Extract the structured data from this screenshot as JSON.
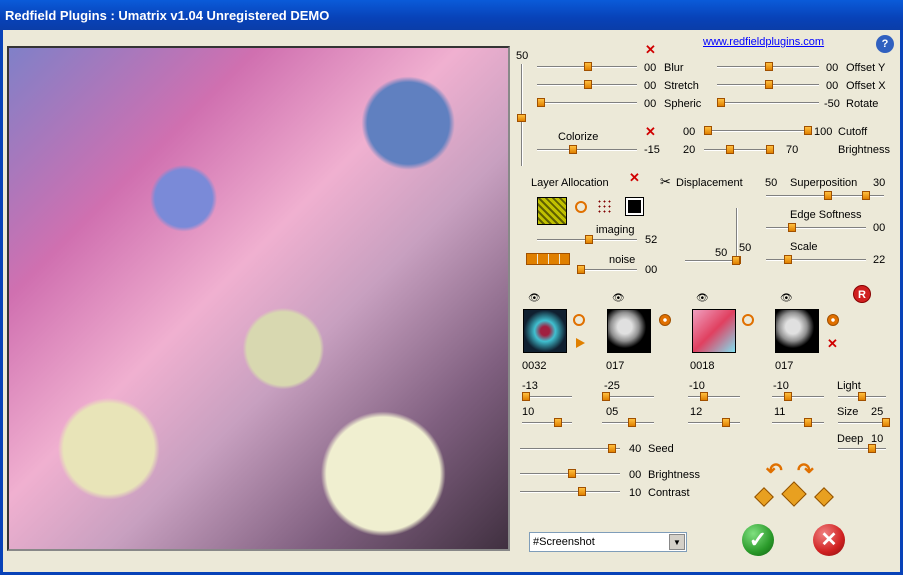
{
  "title": "Redfield Plugins : Umatrix v1.04    Unregistered  DEMO",
  "link": "www.redfieldplugins.com",
  "help": "?",
  "top": {
    "v50": "50",
    "blur": {
      "val": "00",
      "label": "Blur"
    },
    "stretch": {
      "val": "00",
      "label": "Stretch"
    },
    "spheric": {
      "val": "00",
      "label": "Spheric"
    },
    "offsety": {
      "val": "00",
      "label": "Offset Y"
    },
    "offsetx": {
      "val": "00",
      "label": "Offset X"
    },
    "rotate": {
      "val": "-50",
      "label": "Rotate"
    },
    "colorize": {
      "label": "Colorize",
      "val": "-15"
    },
    "cutoff": {
      "lo": "00",
      "hi": "100",
      "label": "Cutoff"
    },
    "brightness": {
      "lo": "20",
      "hi": "70",
      "label": "Brightness"
    }
  },
  "layer": {
    "label": "Layer Allocation",
    "imaging": "imaging",
    "imaging_val": "52",
    "noise": "noise",
    "noise_val": "00"
  },
  "disp": {
    "label": "Displacement",
    "v50a": "50",
    "v50b": "50"
  },
  "superpos": {
    "lo": "50",
    "label": "Superposition",
    "hi": "30"
  },
  "edge": {
    "label": "Edge Softness",
    "val": "00"
  },
  "scale": {
    "label": "Scale",
    "val": "22"
  },
  "r_icon": "R",
  "tiles": [
    {
      "id": "0032",
      "a": "-13",
      "b": "10"
    },
    {
      "id": "017",
      "a": "-25",
      "b": "05"
    },
    {
      "id": "0018",
      "a": "-10",
      "b": "12"
    },
    {
      "id": "017",
      "a": "-10",
      "b": "11"
    }
  ],
  "light": {
    "label": "Light",
    "size_label": "Size",
    "size": "25",
    "deep_label": "Deep",
    "deep": "10"
  },
  "seed": {
    "val": "40",
    "label": "Seed"
  },
  "bottom": {
    "brightness_val": "00",
    "brightness_label": "Brightness",
    "contrast_val": "10",
    "contrast_label": "Contrast"
  },
  "preset": "#Screenshot",
  "colors": {
    "accent": "#e08000",
    "title": "#0a5bd9",
    "ok": "#2a9a2a",
    "cancel": "#d02020"
  }
}
